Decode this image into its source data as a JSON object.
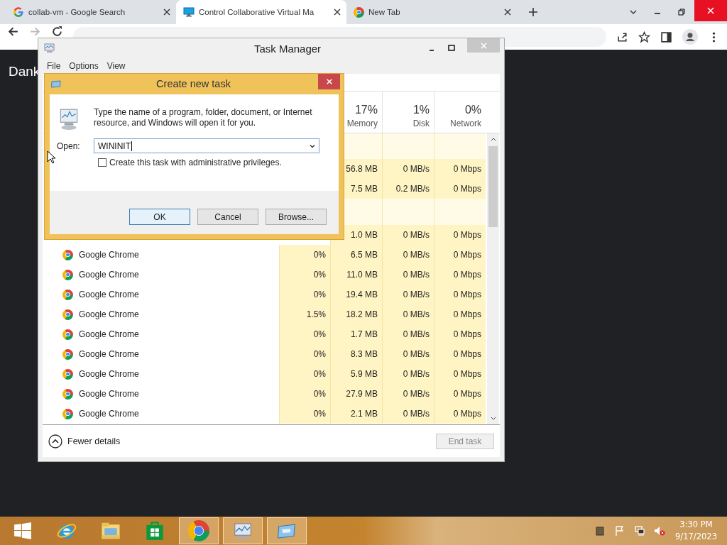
{
  "browser": {
    "tabs": [
      {
        "title": "collab-vm - Google Search",
        "selected": false
      },
      {
        "title": "Control Collaborative Virtual Ma",
        "selected": true
      },
      {
        "title": "New Tab",
        "selected": false
      }
    ]
  },
  "page": {
    "heading": "Dank"
  },
  "task_manager": {
    "title": "Task Manager",
    "menu": [
      "File",
      "Options",
      "View"
    ],
    "columns": [
      {
        "percent": "17%",
        "label": "Memory"
      },
      {
        "percent": "1%",
        "label": "Disk"
      },
      {
        "percent": "0%",
        "label": "Network"
      }
    ],
    "rows": [
      {
        "kind": "section"
      },
      {
        "kind": "process",
        "memory": "56.8 MB",
        "disk": "0 MB/s",
        "network": "0 Mbps"
      },
      {
        "kind": "process",
        "memory": "7.5 MB",
        "disk": "0.2 MB/s",
        "network": "0 Mbps"
      },
      {
        "kind": "section"
      },
      {
        "kind": "process",
        "memory": "1.0 MB",
        "disk": "0 MB/s",
        "network": "0 Mbps"
      },
      {
        "kind": "process",
        "name": "Google Chrome",
        "cpu": "0%",
        "memory": "6.5 MB",
        "disk": "0 MB/s",
        "network": "0 Mbps"
      },
      {
        "kind": "process",
        "name": "Google Chrome",
        "cpu": "0%",
        "memory": "11.0 MB",
        "disk": "0 MB/s",
        "network": "0 Mbps"
      },
      {
        "kind": "process",
        "name": "Google Chrome",
        "cpu": "0%",
        "memory": "19.4 MB",
        "disk": "0 MB/s",
        "network": "0 Mbps"
      },
      {
        "kind": "process",
        "name": "Google Chrome",
        "cpu": "1.5%",
        "memory": "18.2 MB",
        "disk": "0 MB/s",
        "network": "0 Mbps"
      },
      {
        "kind": "process",
        "name": "Google Chrome",
        "cpu": "0%",
        "memory": "1.7 MB",
        "disk": "0 MB/s",
        "network": "0 Mbps"
      },
      {
        "kind": "process",
        "name": "Google Chrome",
        "cpu": "0%",
        "memory": "8.3 MB",
        "disk": "0 MB/s",
        "network": "0 Mbps"
      },
      {
        "kind": "process",
        "name": "Google Chrome",
        "cpu": "0%",
        "memory": "5.9 MB",
        "disk": "0 MB/s",
        "network": "0 Mbps"
      },
      {
        "kind": "process",
        "name": "Google Chrome",
        "cpu": "0%",
        "memory": "27.9 MB",
        "disk": "0 MB/s",
        "network": "0 Mbps"
      },
      {
        "kind": "process",
        "name": "Google Chrome",
        "cpu": "0%",
        "memory": "2.1 MB",
        "disk": "0 MB/s",
        "network": "0 Mbps"
      }
    ],
    "footer": {
      "toggle": "Fewer details",
      "end_task": {
        "label": "End task",
        "disabled": true
      }
    }
  },
  "dialog": {
    "title": "Create new task",
    "message": "Type the name of a program, folder, document, or Internet resource, and Windows will open it for you.",
    "open_label": "Open:",
    "value": "WININIT",
    "admin": {
      "label": "Create this task with administrative privileges.",
      "checked": false
    },
    "buttons": [
      {
        "label": "OK",
        "selected": true
      },
      {
        "label": "Cancel",
        "selected": false
      },
      {
        "label": "Browse...",
        "selected": false
      }
    ]
  },
  "taskbar": {
    "apps": [
      {
        "kind": "start",
        "active": false
      },
      {
        "kind": "ie",
        "active": false
      },
      {
        "kind": "explorer",
        "active": false
      },
      {
        "kind": "store",
        "active": false
      },
      {
        "kind": "chrome",
        "active": true
      },
      {
        "kind": "taskmgr",
        "active": true
      },
      {
        "kind": "run",
        "active": true
      }
    ],
    "clock": {
      "time": "3:30 PM",
      "date": "9/17/2023"
    }
  }
}
